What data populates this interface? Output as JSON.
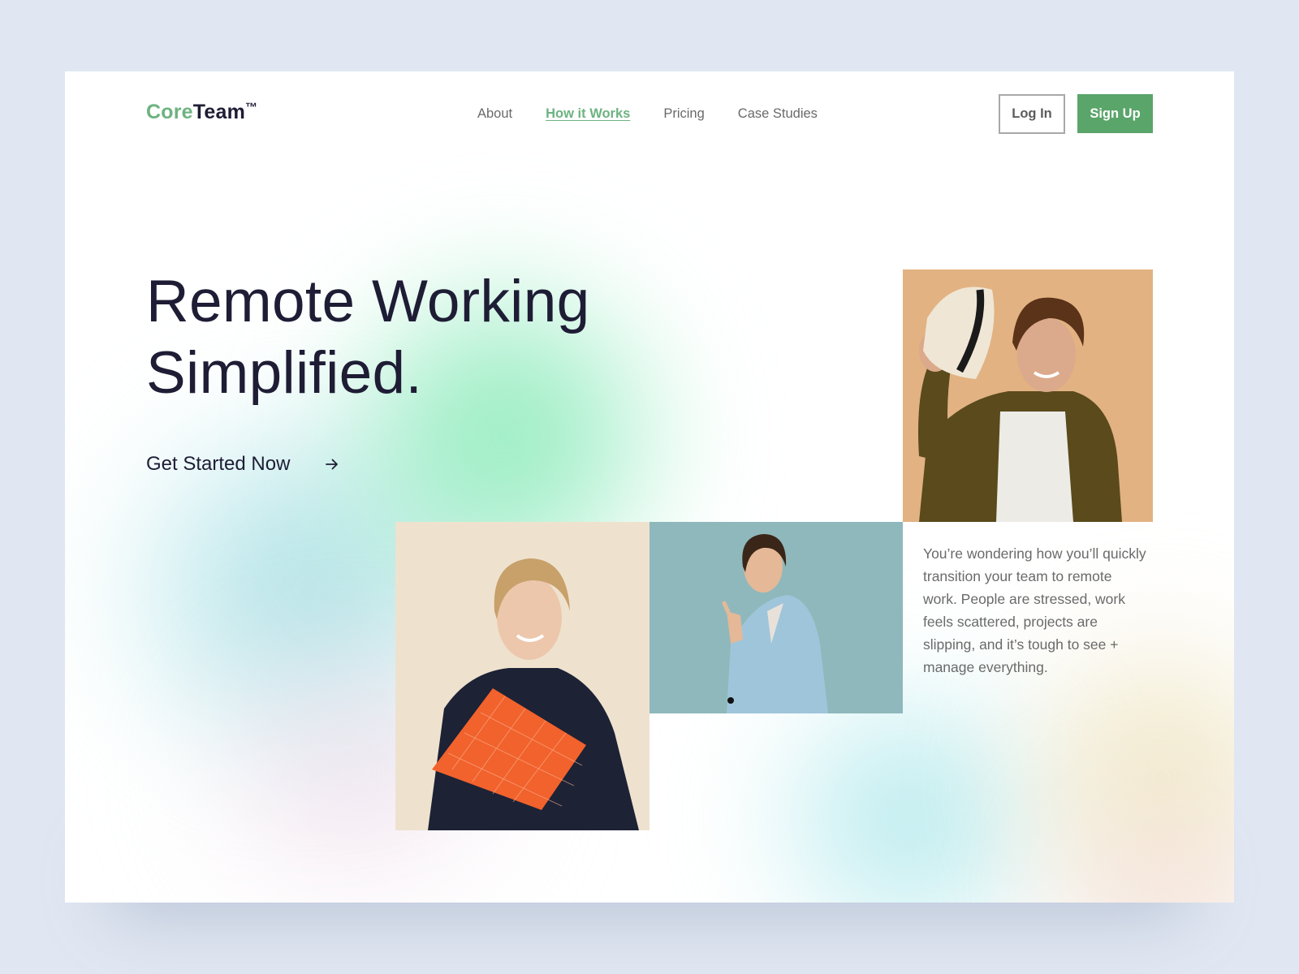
{
  "brand": {
    "logo_part1": "Core",
    "logo_part2": "Team",
    "logo_mark": "™",
    "accent_color": "#6db380",
    "button_color": "#5aa56a",
    "text_dark": "#1e1d35"
  },
  "nav": {
    "items": [
      {
        "label": "About",
        "active": false
      },
      {
        "label": "How it Works",
        "active": true
      },
      {
        "label": "Pricing",
        "active": false
      },
      {
        "label": "Case Studies",
        "active": false
      }
    ]
  },
  "auth": {
    "login_label": "Log In",
    "signup_label": "Sign Up"
  },
  "hero": {
    "title_line1": "Remote Working",
    "title_line2": "Simplified.",
    "cta_label": "Get Started Now",
    "cta_icon": "arrow-right-icon"
  },
  "description": "You’re wondering how you’ll quickly transition your team to remote work. People are stressed, work feels scattered, projects are slipping, and it’s tough to see + manage everything.",
  "photos": [
    {
      "name": "man-with-hat-photo",
      "description": "Smiling man tipping a straw hat, olive jacket, tan background"
    },
    {
      "name": "woman-with-book-photo",
      "description": "Smiling woman holding an orange book, navy sweater, cream background"
    },
    {
      "name": "woman-pointing-photo",
      "description": "Woman in light blue blazer pointing, teal background"
    }
  ]
}
